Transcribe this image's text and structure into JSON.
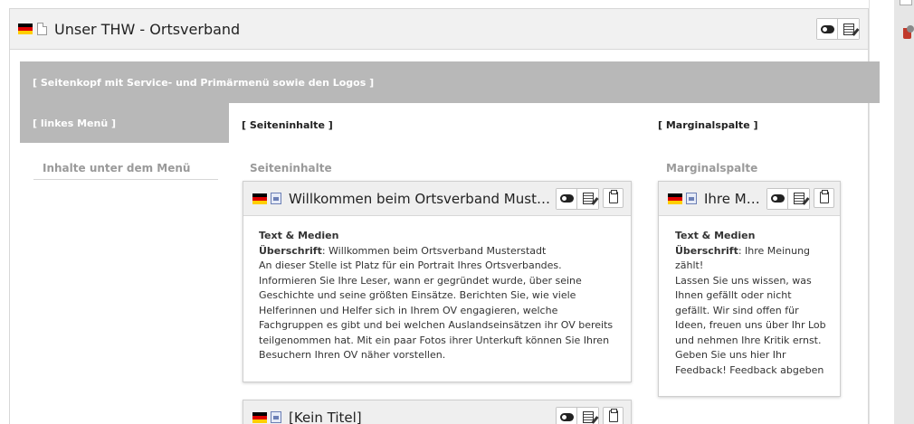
{
  "page": {
    "title": "Unser THW - Ortsverband"
  },
  "layout": {
    "banner": "[ Seitenkopf mit Service- und Primärmenü sowie den Logos ]",
    "left_label": "[ linkes Menü ]",
    "main_label": "[ Seiteninhalte ]",
    "side_label": "[ Marginalspalte ]"
  },
  "columns": {
    "left_title": "Inhalte unter dem Menü",
    "main_title": "Seiteninhalte",
    "side_title": "Marginalspalte"
  },
  "elements": {
    "welcome": {
      "title": "Willkommen beim Ortsverband Musterst...",
      "ctype": "Text & Medien",
      "header_label": "Überschrift",
      "header_value": ": Willkommen beim Ortsverband Musterstadt",
      "bodytext": "An dieser Stelle ist Platz für ein Portrait Ihres Ortsverbandes. Informieren Sie Ihre Leser, wann er gegründet wurde, über seine Geschichte und seine größten Einsätze. Berichten Sie, wie viele Helferinnen und Helfer sich in Ihrem OV engagieren, welche Fachgruppen es gibt und bei welchen Auslandseinsätzen ihr OV bereits teilgenommen hat. Mit ein paar Fotos ihrer Unterkuft können Sie Ihren Besuchern Ihren OV näher vorstellen."
    },
    "feedback": {
      "title": "Ihre Me...",
      "ctype": "Text & Medien",
      "header_label": "Überschrift",
      "header_value": ": Ihre Meinung zählt!",
      "bodytext": "Lassen Sie uns wissen, was Ihnen gefällt oder nicht gefällt. Wir sind offen für Ideen, freuen uns über Ihr Lob und nehmen Ihre Kritik ernst. Geben Sie uns hier Ihr Feedback! Feedback abgeben"
    },
    "untitled": {
      "title": "[Kein Titel]"
    }
  },
  "icons": {
    "language_flag": "flag-de-icon",
    "page": "page-icon",
    "content_element": "content-element-icon",
    "visibility": "toggle-visibility-icon",
    "edit": "edit-icon",
    "clipboard": "clipboard-icon",
    "delete": "trash-icon"
  },
  "colors": {
    "banner_bg": "#b8b8b8",
    "panel_header_bg": "#f1f1f1",
    "card_header_bg": "#efefef",
    "muted_title": "#9a9a9a"
  }
}
